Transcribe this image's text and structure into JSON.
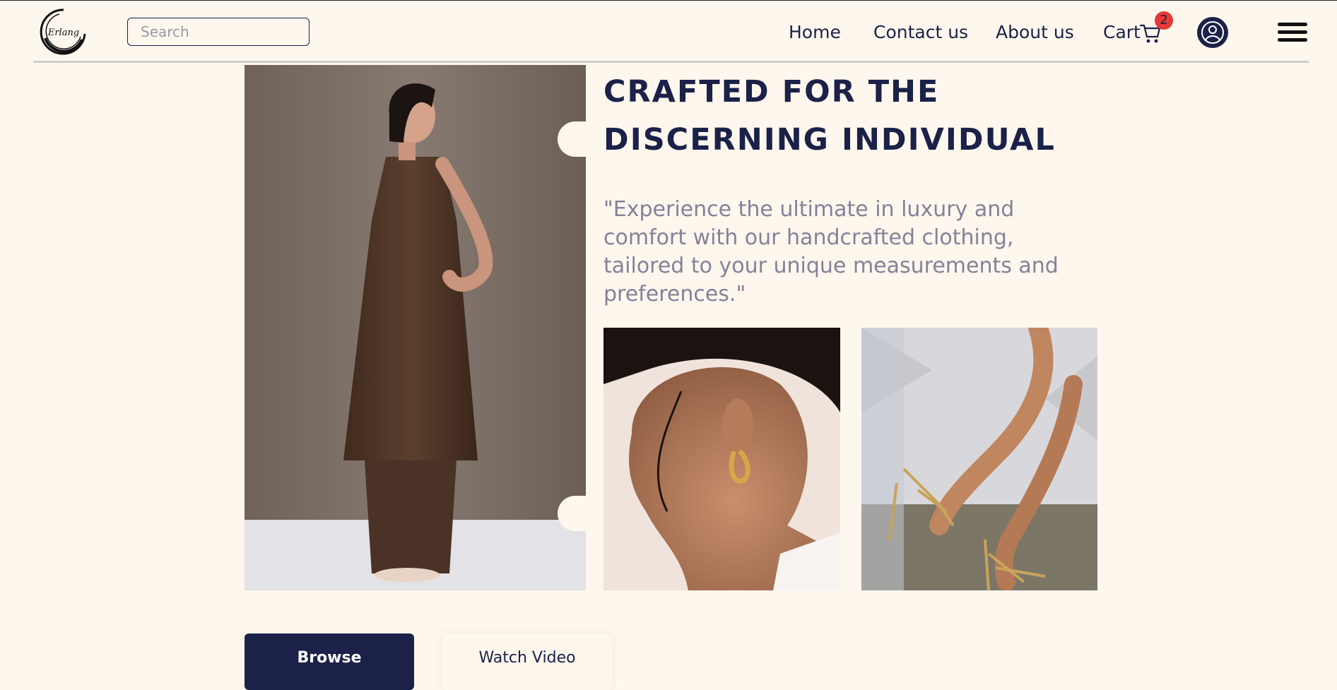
{
  "header": {
    "logo_text": "Erlang",
    "search_placeholder": "Search",
    "nav": {
      "home": "Home",
      "contact": "Contact us",
      "about": "About us",
      "cart": "Cart"
    },
    "cart_count": "2",
    "icons": [
      "logo",
      "cart-icon",
      "user-icon",
      "hamburger-menu-icon"
    ]
  },
  "hero": {
    "headline_line1": "CRAFTED FOR THE",
    "headline_line2": "DISCERNING INDIVIDUAL",
    "quote": "\"Experience the ultimate in luxury and comfort with our handcrafted clothing, tailored to your unique measurements and preferences.\"",
    "buttons": {
      "browse": "Browse",
      "watch_video": "Watch Video"
    }
  },
  "colors": {
    "background": "#fef7ee",
    "navy": "#1b2148",
    "muted_text": "#858199",
    "badge": "#e53935"
  }
}
